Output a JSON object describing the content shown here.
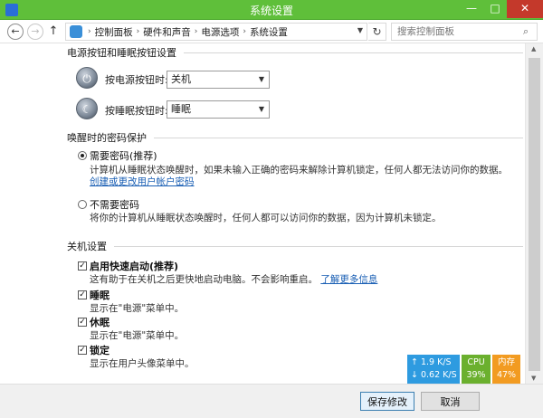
{
  "window": {
    "title": "系统设置",
    "minimize_glyph": "—",
    "maximize_glyph": "□",
    "close_glyph": "✕"
  },
  "address": {
    "back_glyph": "←",
    "forward_glyph": "→",
    "up_glyph": "↑",
    "breadcrumb": [
      "控制面板",
      "硬件和声音",
      "电源选项",
      "系统设置"
    ],
    "separator": "›",
    "refresh_glyph": "↻",
    "search_placeholder": "搜索控制面板",
    "search_glyph": "⌕"
  },
  "sections": {
    "power_buttons": {
      "title": "电源按钮和睡眠按钮设置",
      "power_label": "按电源按钮时:",
      "power_value": "关机",
      "sleep_label": "按睡眠按钮时:",
      "sleep_value": "睡眠"
    },
    "wake_password": {
      "title": "唤醒时的密码保护",
      "require_label": "需要密码(推荐)",
      "require_desc": "计算机从睡眠状态唤醒时，如果未输入正确的密码来解除计算机锁定，任何人都无法访问你的数据。",
      "require_link": "创建或更改用户帐户密码",
      "norequire_label": "不需要密码",
      "norequire_desc": "将你的计算机从睡眠状态唤醒时，任何人都可以访问你的数据，因为计算机未锁定。"
    },
    "shutdown": {
      "title": "关机设置",
      "fast_label": "启用快速启动(推荐)",
      "fast_desc": "这有助于在关机之后更快地启动电脑。不会影响重启。",
      "fast_link": "了解更多信息",
      "sleep_label": "睡眠",
      "sleep_desc": "显示在\"电源\"菜单中。",
      "hibernate_label": "休眠",
      "hibernate_desc": "显示在\"电源\"菜单中。",
      "lock_label": "锁定",
      "lock_desc": "显示在用户头像菜单中。"
    }
  },
  "footer": {
    "save_label": "保存修改",
    "cancel_label": "取消"
  },
  "widget": {
    "upload": "↑  1.9 K/S",
    "download": "↓ 0.62 K/S",
    "cpu_label": "CPU",
    "cpu_value": "39%",
    "mem_label": "内存",
    "mem_value": "47%"
  },
  "colors": {
    "titlebar": "#5fbf3a",
    "link": "#1a5fb4",
    "net": "#2e9be0",
    "cpu": "#6bb02e",
    "mem": "#f29b21"
  }
}
